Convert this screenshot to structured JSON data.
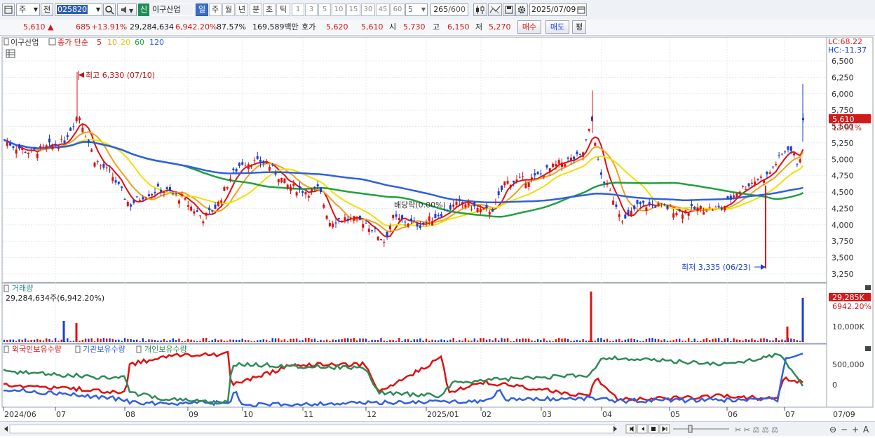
{
  "toolbar": {
    "market": "주",
    "prev_label": "전",
    "code": "025820",
    "new_badge": "신",
    "stock_name": "이구산업",
    "periods": [
      "일",
      "주",
      "월",
      "년",
      "분",
      "초",
      "틱"
    ],
    "active_period": "일",
    "intervals": [
      "1",
      "3",
      "5",
      "10",
      "15",
      "30",
      "45",
      "60"
    ],
    "interval_value": "5",
    "count": "265",
    "count_total": "/600",
    "date": "2025/07/09"
  },
  "quote": {
    "price": "5,610",
    "change_arrow": "▲",
    "change": "685",
    "change_pct": "+13.91%",
    "volume": "29,284,634",
    "volume_ratio": "6,942.20%",
    "turnover_pct": "87.57%",
    "amount": "169,589백만",
    "hoga_label": "호가",
    "ask": "5,620",
    "bid": "5,610",
    "open_label": "시",
    "open": "5,730",
    "high_label": "고",
    "high": "6,150",
    "low_label": "저",
    "low": "5,270",
    "buy_label": "매수",
    "sell_label": "매도",
    "eval_label": "평"
  },
  "price_panel": {
    "legend_name": "이구산업",
    "legend_title": "종가 단순",
    "ma": [
      {
        "label": "5",
        "color": "#e01010"
      },
      {
        "label": "10",
        "color": "#f0a020"
      },
      {
        "label": "20",
        "color": "#f0e000"
      },
      {
        "label": "60",
        "color": "#20a040"
      },
      {
        "label": "120",
        "color": "#3060e0"
      }
    ],
    "lc": "LC:68.22",
    "hc": "HC:-11.37",
    "y_ticks": [
      "6,500",
      "6,250",
      "6,000",
      "5,750",
      "5,500",
      "5,250",
      "5,000",
      "4,750",
      "4,500",
      "4,250",
      "4,000",
      "3,750",
      "3,500",
      "3,250"
    ],
    "y_values": [
      6500,
      6250,
      6000,
      5750,
      5500,
      5250,
      5000,
      4750,
      4500,
      4250,
      4000,
      3750,
      3500,
      3250
    ],
    "current_price": "5,610",
    "current_pct": "13.91%",
    "high_annotation": "최고 6,330 (07/10)",
    "low_annotation": "최저 3,335 (06/23)",
    "dividend_annotation": "배당락(0.00%)"
  },
  "volume_panel": {
    "title": "거래량",
    "value_text": "29,284,634주(6,942.20%)",
    "current_label": "29,285K",
    "current_pct": "6942.20%",
    "tick": "10,000K"
  },
  "holdings_panel": {
    "legends": [
      {
        "label": "외국인보유수량",
        "color": "#e01010"
      },
      {
        "label": "기관보유수량",
        "color": "#3060e0"
      },
      {
        "label": "개인보유수량",
        "color": "#2e8b57"
      }
    ],
    "ticks": [
      "500,000",
      "0"
    ]
  },
  "x_axis": [
    "2024/06",
    "07",
    "08",
    "09",
    "10",
    "11",
    "12",
    "2025/01",
    "02",
    "03",
    "04",
    "05",
    "06",
    "07",
    "07/09"
  ],
  "colors": {
    "up": "#e01010",
    "down": "#1a3ed2",
    "accent": "#3b6fc4"
  }
}
